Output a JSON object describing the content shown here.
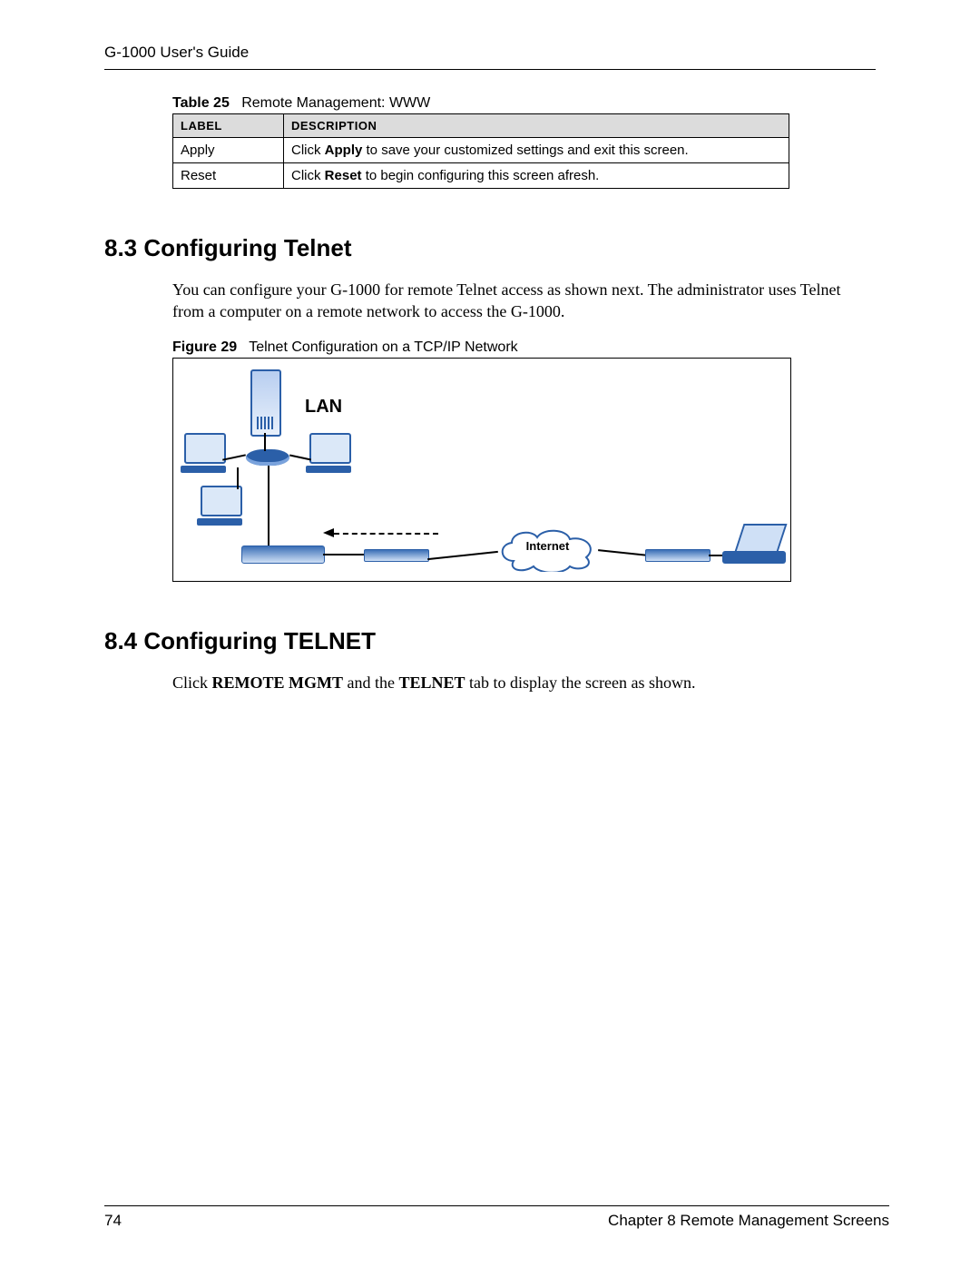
{
  "header": {
    "title": "G-1000 User's Guide"
  },
  "table25": {
    "caption_prefix": "Table 25",
    "caption_text": "Remote Management: WWW",
    "columns": {
      "label": "LABEL",
      "description": "DESCRIPTION"
    },
    "rows": [
      {
        "label": "Apply",
        "desc_pre": "Click ",
        "desc_bold": "Apply",
        "desc_post": " to save your customized settings and exit this screen."
      },
      {
        "label": "Reset",
        "desc_pre": "Click ",
        "desc_bold": "Reset",
        "desc_post": " to begin configuring this screen afresh."
      }
    ]
  },
  "section83": {
    "heading": "8.3  Configuring Telnet",
    "paragraph": "You can configure your G-1000 for remote Telnet access as shown next. The administrator uses Telnet from a computer on a remote network to access the G-1000."
  },
  "figure29": {
    "caption_prefix": "Figure 29",
    "caption_text": "Telnet Configuration on a TCP/IP Network",
    "lan_label": "LAN",
    "internet_label": "Internet"
  },
  "section84": {
    "heading": "8.4  Configuring TELNET",
    "para_pre": "Click ",
    "para_b1": "REMOTE MGMT",
    "para_mid": " and the ",
    "para_b2": "TELNET",
    "para_post": " tab to display the screen as shown."
  },
  "footer": {
    "page_number": "74",
    "chapter": "Chapter 8 Remote Management Screens"
  }
}
